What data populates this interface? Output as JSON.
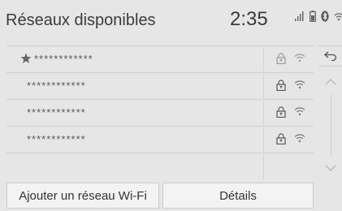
{
  "header": {
    "title": "Réseaux disponibles",
    "clock": "2:35"
  },
  "networks": [
    {
      "name": "************",
      "favorite": true
    },
    {
      "name": "************",
      "favorite": false
    },
    {
      "name": "************",
      "favorite": false
    },
    {
      "name": "************",
      "favorite": false
    }
  ],
  "buttons": {
    "add_label": "Ajouter un réseau Wi-Fi",
    "details_label": "Détails"
  },
  "icons": {
    "status": [
      "signal-bars-icon",
      "battery-icon",
      "bluetooth-icon",
      "wifi-icon"
    ],
    "row": [
      "star-icon",
      "lock-icon",
      "wifi-icon"
    ],
    "side": [
      "back-icon",
      "chevron-up-icon",
      "chevron-down-icon"
    ]
  },
  "colors": {
    "background": "#e6e6e6",
    "text": "#333333",
    "button": "#f3f3f3"
  }
}
